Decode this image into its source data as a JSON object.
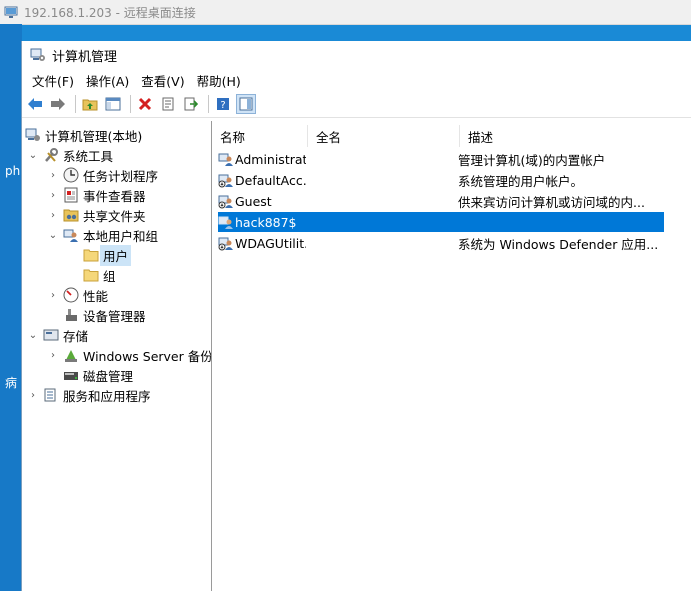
{
  "rdp": {
    "title": "192.168.1.203 - 远程桌面连接"
  },
  "desktop": {
    "frag1": "ph",
    "frag2": "病"
  },
  "window": {
    "title": "计算机管理"
  },
  "menu": {
    "file": "文件(F)",
    "action": "操作(A)",
    "view": "查看(V)",
    "help": "帮助(H)"
  },
  "tree": {
    "root": "计算机管理(本地)",
    "system_tools": "系统工具",
    "task_scheduler": "任务计划程序",
    "event_viewer": "事件查看器",
    "shared_folders": "共享文件夹",
    "local_users_groups": "本地用户和组",
    "users": "用户",
    "groups": "组",
    "performance": "性能",
    "device_manager": "设备管理器",
    "storage": "存储",
    "windows_server_backup": "Windows Server 备份",
    "disk_management": "磁盘管理",
    "services_apps": "服务和应用程序"
  },
  "columns": {
    "name": "名称",
    "fullname": "全名",
    "description": "描述"
  },
  "users": [
    {
      "name": "Administrat...",
      "fullname": "",
      "description": "管理计算机(域)的内置帐户",
      "selected": false
    },
    {
      "name": "DefaultAcc...",
      "fullname": "",
      "description": "系统管理的用户帐户。",
      "selected": false
    },
    {
      "name": "Guest",
      "fullname": "",
      "description": "供来宾访问计算机或访问域的内...",
      "selected": false
    },
    {
      "name": "hack887$",
      "fullname": "",
      "description": "",
      "selected": true
    },
    {
      "name": "WDAGUtilit...",
      "fullname": "",
      "description": "系统为 Windows Defender 应用...",
      "selected": false
    }
  ],
  "colors": {
    "selection": "#0078d7",
    "tree_selection": "#cce4f7",
    "desktop": "#1a8ad6"
  }
}
